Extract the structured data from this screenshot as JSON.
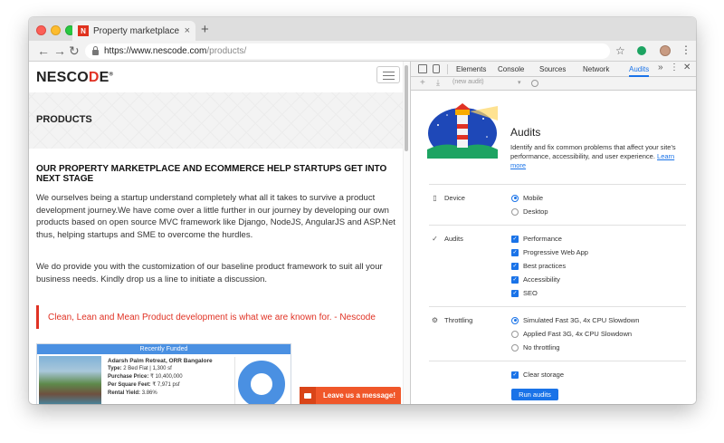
{
  "browser": {
    "tab_title": "Property marketplace and eco",
    "tab_close": "×",
    "new_tab": "+",
    "url_host": "https://www.nescode.com",
    "url_path": "/products/"
  },
  "site": {
    "logo_pre": "NESCO",
    "logo_d": "D",
    "logo_post": "E",
    "logo_mark": "®",
    "hero_title": "PRODUCTS",
    "heading": "OUR PROPERTY MARKETPLACE AND ECOMMERCE HELP STARTUPS GET INTO NEXT STAGE",
    "para1": "We ourselves being a startup understand completely what all it takes to survive a product development journey.We have come over a little further in our journey by developing our own products based on open source MVC framework like Django, NodeJS, AngularJS and ASP.Net thus, helping startups and SME to overcome the hurdles.",
    "para2": "We do provide you with the customization of our baseline product framework to suit all your business needs. Kindly drop us a line to initiate a discussion.",
    "quote": "Clean, Lean and Mean Product development is what we are known for. - Nescode",
    "card": {
      "header": "Recently Funded",
      "name": "Adarsh Palm Retreat, ORR Bangalore",
      "type_label": "Type:",
      "type_value": "2 Bed Flat | 1,300 sf",
      "price_label": "Purchase Price:",
      "price_value": "₹ 10,400,000",
      "psf_label": "Per Square Feet:",
      "psf_value": "₹ 7,971 psf",
      "yield_label": "Rental Yield:",
      "yield_value": "3.86%"
    },
    "message_button": "Leave us a message!"
  },
  "devtools": {
    "tabs": [
      "Elements",
      "Console",
      "Sources",
      "Network",
      "Audits"
    ],
    "active_tab": "Audits",
    "more": "»",
    "kebab": "⋮",
    "close": "✕",
    "audit_select": "(new audit)",
    "audits_title": "Audits",
    "audits_desc": "Identify and fix common problems that affect your site's performance, accessibility, and user experience.",
    "learn_more": "Learn more",
    "device_label": "Device",
    "device_options": [
      "Mobile",
      "Desktop"
    ],
    "audits_label": "Audits",
    "audit_options": [
      "Performance",
      "Progressive Web App",
      "Best practices",
      "Accessibility",
      "SEO"
    ],
    "throttling_label": "Throttling",
    "throttling_options": [
      "Simulated Fast 3G, 4x CPU Slowdown",
      "Applied Fast 3G, 4x CPU Slowdown",
      "No throttling"
    ],
    "clear_storage": "Clear storage",
    "run_button": "Run audits"
  },
  "colors": {
    "accent": "#1a73e8",
    "brand": "#e03224",
    "message": "#f0572a"
  }
}
